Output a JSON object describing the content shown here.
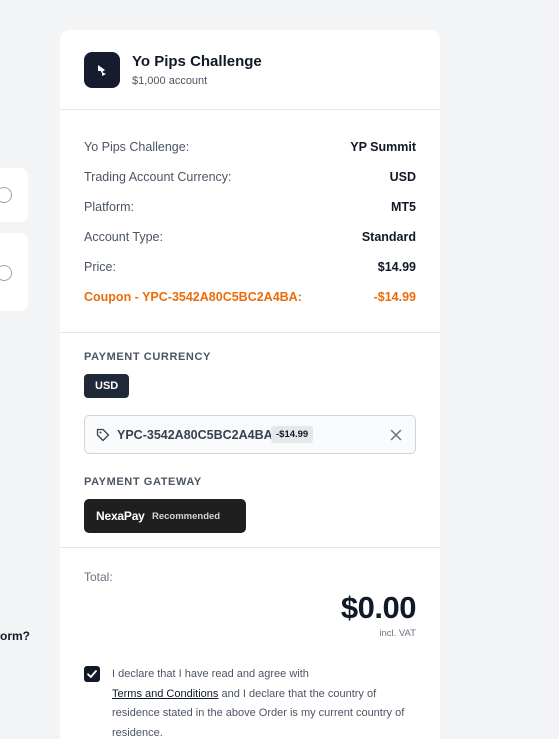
{
  "left_panel": {
    "question_fragment": "orm?"
  },
  "header": {
    "title": "Yo Pips Challenge",
    "subtitle": "$1,000 account"
  },
  "summary": {
    "rows": [
      {
        "label": "Yo Pips Challenge:",
        "value": "YP Summit"
      },
      {
        "label": "Trading Account Currency:",
        "value": "USD"
      },
      {
        "label": "Platform:",
        "value": "MT5"
      },
      {
        "label": "Account Type:",
        "value": "Standard"
      },
      {
        "label": "Price:",
        "value": "$14.99"
      }
    ],
    "coupon": {
      "label": "Coupon - YPC-3542A80C5BC2A4BA:",
      "value": "-$14.99"
    }
  },
  "payment": {
    "currency_label": "PAYMENT CURRENCY",
    "currency_selected": "USD",
    "coupon_code": "YPC-3542A80C5BC2A4BA",
    "coupon_discount": "-$14.99",
    "gateway_label": "PAYMENT GATEWAY",
    "gateway_name": "NexaPay",
    "gateway_badge": "Recommended"
  },
  "total": {
    "label": "Total:",
    "amount": "$0.00",
    "vat_note": "incl. VAT"
  },
  "declaration": {
    "checked": true,
    "text_before": "I declare that I have read and agree with",
    "terms_link": "Terms and Conditions",
    "text_after": "and I declare that the country of residence stated in the above Order is my current country of residence."
  },
  "colors": {
    "accent_coupon": "#ea6c0a",
    "dark": "#1f2937",
    "logo_bg": "#161b2e"
  },
  "icons": [
    "logo-icon",
    "tag-icon",
    "close-icon",
    "check-icon"
  ]
}
